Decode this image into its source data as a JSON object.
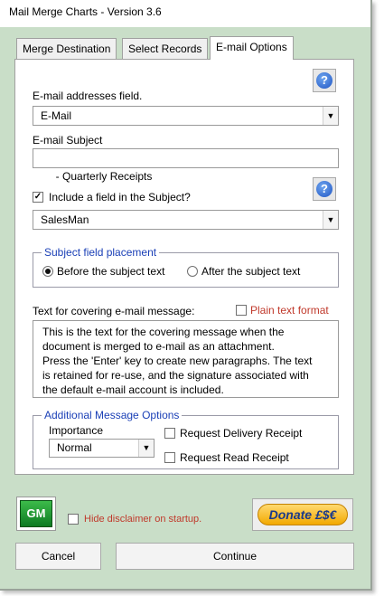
{
  "window": {
    "title": "Mail Merge Charts - Version 3.6"
  },
  "tabs": [
    {
      "label": "Merge Destination",
      "active": false
    },
    {
      "label": "Select Records",
      "active": false
    },
    {
      "label": "E-mail Options",
      "active": true
    }
  ],
  "email_field": {
    "label": "E-mail addresses field.",
    "value": "E-Mail"
  },
  "subject": {
    "label": "E-mail Subject",
    "value": " - Quarterly Receipts"
  },
  "include_field": {
    "label": "Include a field in the Subject?",
    "checked": true,
    "value": "SalesMan"
  },
  "placement": {
    "legend": "Subject field placement",
    "before_label": "Before the subject text",
    "after_label": "After the subject text",
    "selected": "before"
  },
  "message": {
    "label": "Text for covering e-mail message:",
    "plain_text_label": "Plain text format",
    "plain_text_checked": false,
    "lines": [
      "This is the text for the covering message when the",
      "document is merged to e-mail as an attachment.",
      "Press the 'Enter' key to create new paragraphs. The text",
      "is retained for re-use, and the signature associated with",
      "the default e-mail account is included."
    ]
  },
  "additional": {
    "legend": "Additional Message Options",
    "importance_label": "Importance",
    "importance_value": "Normal",
    "delivery_label": "Request Delivery Receipt",
    "read_label": "Request Read Receipt"
  },
  "footer": {
    "gm_label": "GM",
    "disclaimer_label": "Hide disclaimer on startup.",
    "donate_label": "Donate £$€",
    "cancel_label": "Cancel",
    "continue_label": "Continue"
  },
  "colors": {
    "window_bg": "#c9dec8",
    "legend_blue": "#1a3fb6",
    "warning_red": "#c0392b"
  }
}
